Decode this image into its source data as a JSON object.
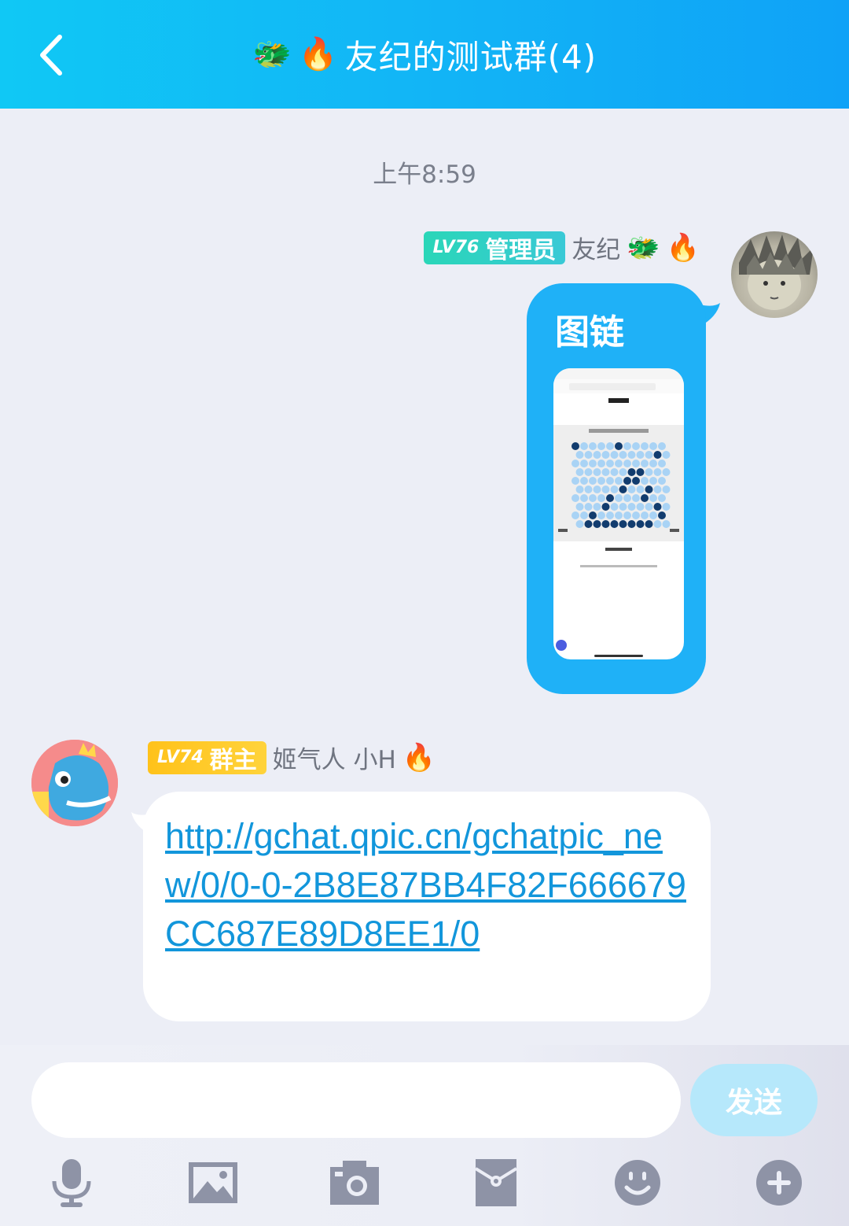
{
  "header": {
    "title": "友纪的测试群(4)",
    "title_emojis": [
      "dragon-icon",
      "fire-icon"
    ]
  },
  "timestamp": "上午8:59",
  "messages": [
    {
      "side": "right",
      "level": "LV76",
      "role": "管理员",
      "sender": "友纪",
      "sender_emojis": [
        "dragon-icon",
        "fire-icon"
      ],
      "text": "图链",
      "has_image": true
    },
    {
      "side": "left",
      "level": "LV74",
      "role": "群主",
      "sender": "姬气人 小H",
      "sender_emojis": [
        "campfire-icon"
      ],
      "text": "http://gchat.qpic.cn/gchatpic_new/0/0-0-2B8E87BB4F82F666679CC687E89D8EE1/0"
    }
  ],
  "input": {
    "value": "",
    "send_label": "发送"
  },
  "toolbar": [
    "microphone-icon",
    "image-icon",
    "camera-icon",
    "red-packet-icon",
    "emoji-icon",
    "plus-icon"
  ],
  "colors": {
    "header": "#12b3f6",
    "bubble_right": "#1fb1f7",
    "link": "#1296db",
    "admin_badge": "#2ad6b8",
    "owner_badge": "#ffc21a",
    "send_button": "#b6e8fb",
    "tool_icon": "#8e93a6"
  }
}
